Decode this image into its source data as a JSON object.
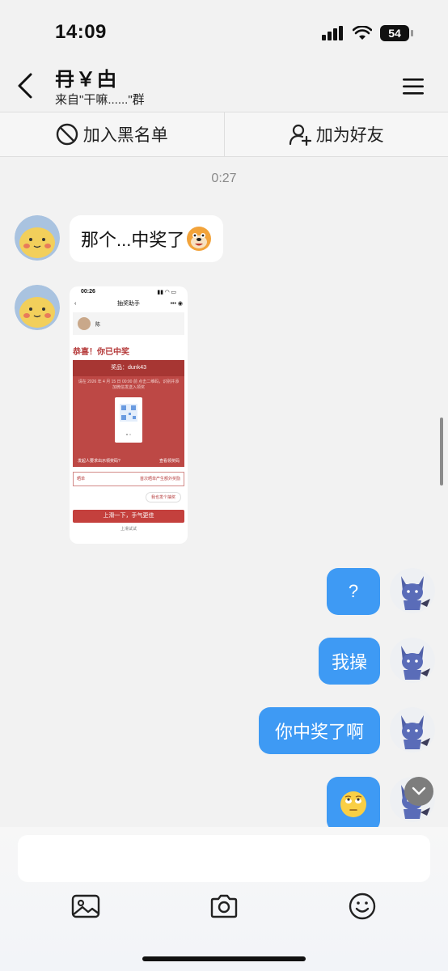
{
  "status": {
    "time": "14:09",
    "battery": "54"
  },
  "header": {
    "title": "冄￥甴",
    "subtitle": "来自\"干嘛......\"群"
  },
  "actions": {
    "blacklist": "加入黑名单",
    "add_friend": "加为好友"
  },
  "chat": {
    "timestamp": "0:27",
    "messages": [
      {
        "side": "left",
        "text": "那个...中奖了"
      },
      {
        "side": "left",
        "type": "image"
      },
      {
        "side": "right",
        "text": "?"
      },
      {
        "side": "right",
        "text": "我操"
      },
      {
        "side": "right",
        "text": "你中奖了啊"
      },
      {
        "side": "right",
        "type": "emoji",
        "text": "🙄"
      }
    ]
  },
  "shared_image": {
    "time": "00:26",
    "nav_title": "抽奖助手",
    "user": "陈",
    "congrats": "恭喜！你已中奖",
    "prize": "奖品：dunk43",
    "info": "请在 2026 年 4 月 15 日 00:00 前 点击二维码，识别并添加微信发送入领奖",
    "footer_left": "发起人要求出示领奖码?",
    "footer_right": "查看领奖码",
    "list_label": "晒单",
    "list_right": "首次晒单产生额外奖励",
    "pill": "我也发个抽奖",
    "button": "上滑一下，手气更佳",
    "hint": "上滑试试"
  },
  "composer": {
    "placeholder": ""
  },
  "colors": {
    "bubble_blue": "#3e9af4",
    "background": "#f2f2f2",
    "prize_red": "#bd4845"
  }
}
